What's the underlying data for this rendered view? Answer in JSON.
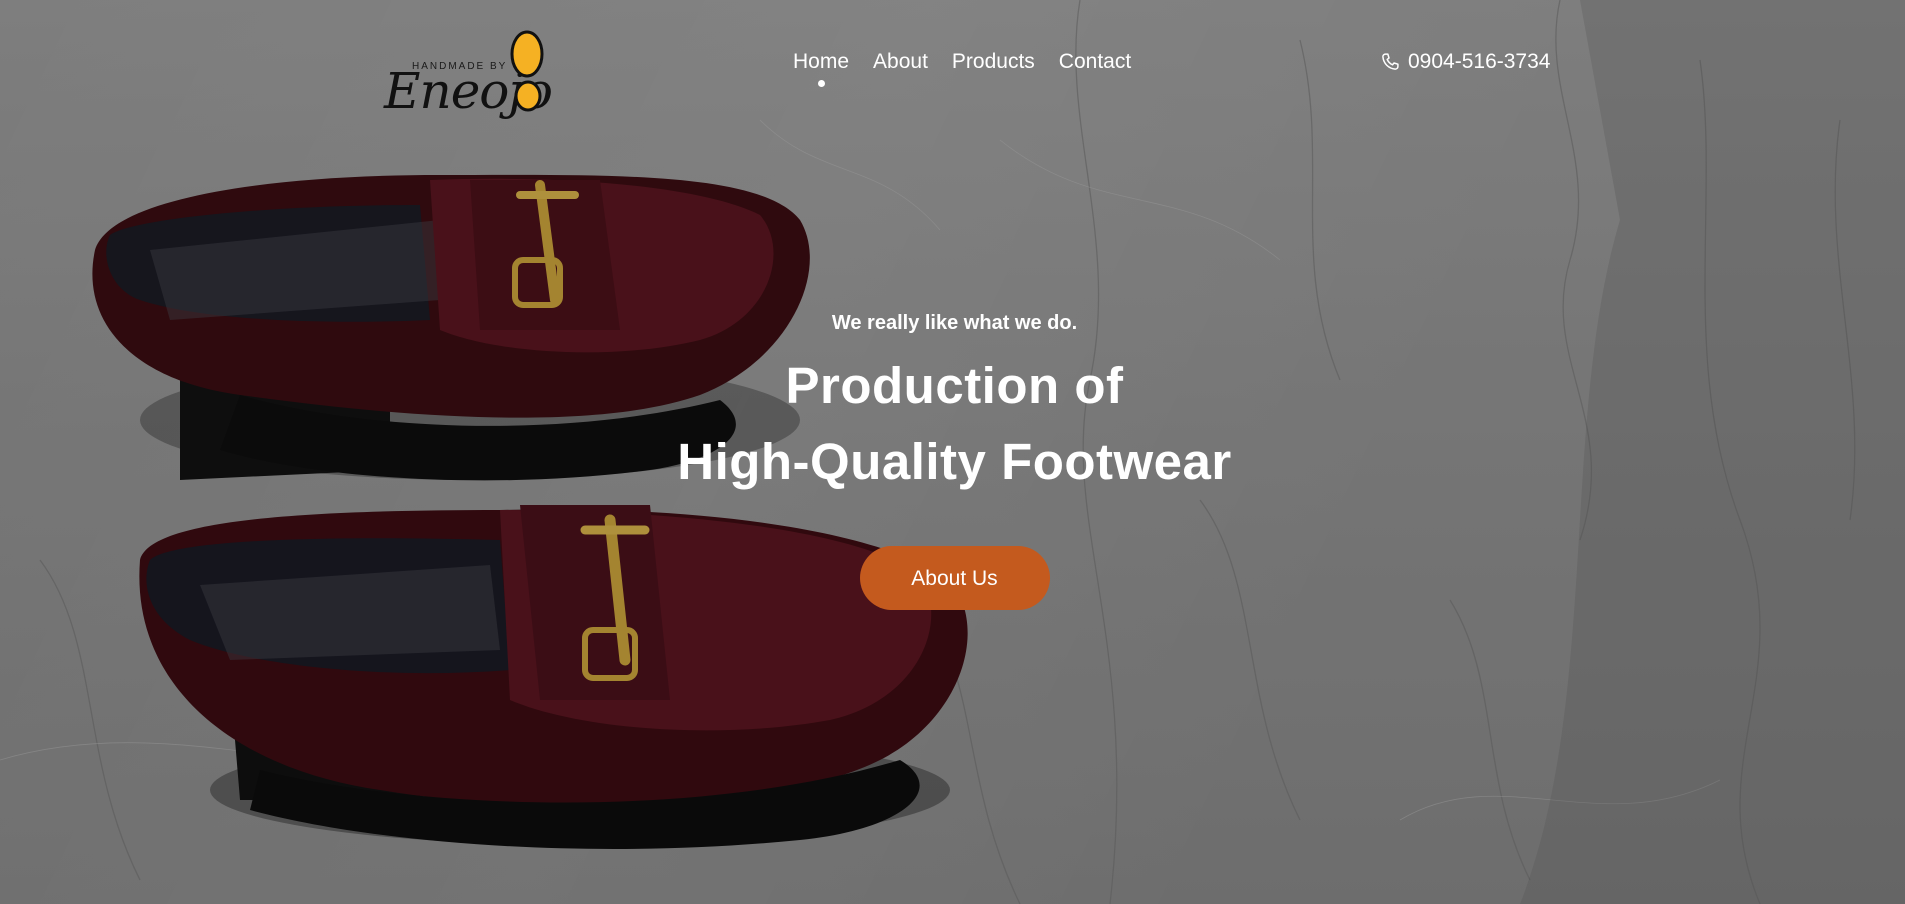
{
  "brand": {
    "tagline": "HANDMADE BY",
    "name": "Eneojo",
    "accent_color": "#f5b123"
  },
  "nav": {
    "items": [
      {
        "label": "Home",
        "active": true
      },
      {
        "label": "About",
        "active": false
      },
      {
        "label": "Products",
        "active": false
      },
      {
        "label": "Contact",
        "active": false
      }
    ]
  },
  "contact": {
    "icon": "phone-icon",
    "phone": "0904-516-3734"
  },
  "hero": {
    "tagline": "We really like what we do.",
    "headline_line1": "Production of",
    "headline_line2": "High-Quality Footwear",
    "cta_label": "About Us",
    "cta_color": "#c45a1e",
    "image": "burgundy-patent-loafers-on-marble"
  }
}
